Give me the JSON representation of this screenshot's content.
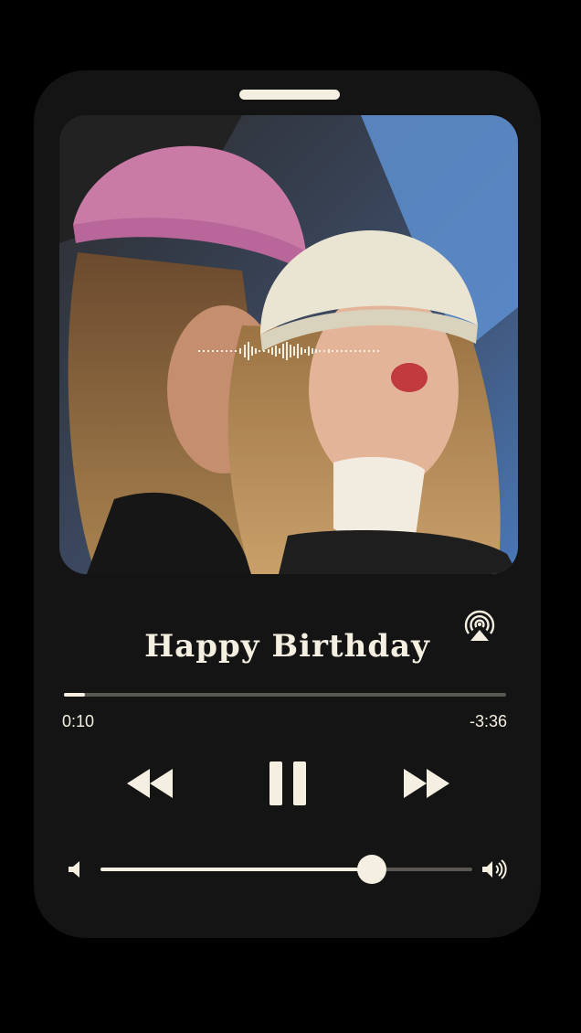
{
  "player": {
    "title": "Happy Birthday",
    "time_elapsed": "0:10",
    "time_remaining": "-3:36",
    "progress_fraction": 0.047,
    "volume_fraction": 0.73,
    "is_playing": true
  },
  "artwork": {
    "description_icon": "photo-artwork"
  },
  "icons": {
    "airplay": "airplay-icon",
    "rewind": "rewind-icon",
    "pause": "pause-icon",
    "forward": "fast-forward-icon",
    "volume_low": "volume-low-icon",
    "volume_high": "volume-high-icon"
  },
  "colors": {
    "background": "#000000",
    "device": "#141414",
    "foreground": "#f4efe0",
    "track": "#5a5752"
  }
}
